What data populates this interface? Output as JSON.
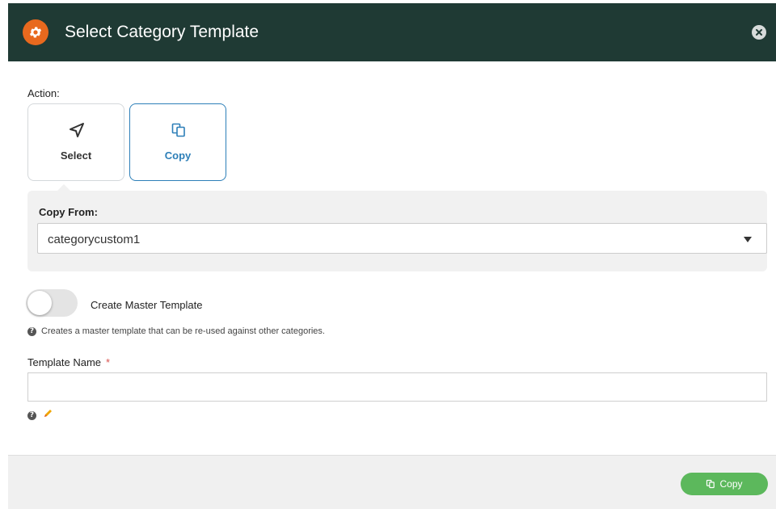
{
  "header": {
    "title": "Select Category Template",
    "icon": "gear-icon",
    "accent_color": "#e8691e",
    "background_color": "#1f3a34"
  },
  "action": {
    "label": "Action:",
    "options": [
      {
        "label": "Select",
        "icon": "navigation-arrow-icon",
        "selected": false
      },
      {
        "label": "Copy",
        "icon": "copy-icon",
        "selected": true
      }
    ]
  },
  "copy_from": {
    "label": "Copy From:",
    "value": "categorycustom1"
  },
  "master_template": {
    "label": "Create Master Template",
    "enabled": false,
    "help_text": "Creates a master template that can be re-used against other categories."
  },
  "template_name": {
    "label": "Template Name",
    "required_marker": "*",
    "value": ""
  },
  "footer": {
    "copy_button_label": "Copy",
    "button_color": "#5cb85c"
  }
}
